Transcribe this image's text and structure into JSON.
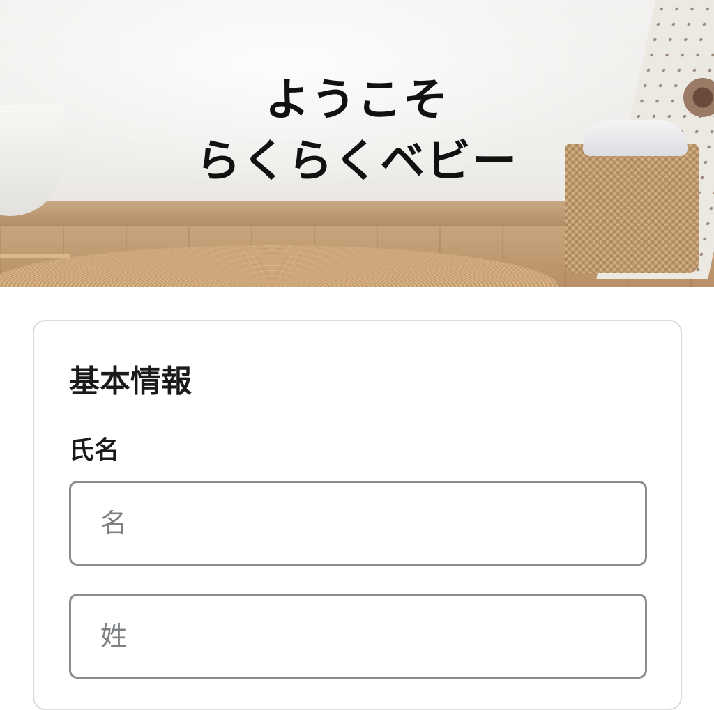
{
  "hero": {
    "title_line1": "ようこそ",
    "title_line2": "らくらくベビー"
  },
  "form": {
    "section_title": "基本情報",
    "name_label": "氏名",
    "first_name_placeholder": "名",
    "last_name_placeholder": "姓",
    "first_name_value": "",
    "last_name_value": ""
  },
  "colors": {
    "text": "#1a1a1a",
    "input_border": "#8a8d90",
    "card_border": "#d9dadc",
    "placeholder": "#7e8184"
  }
}
